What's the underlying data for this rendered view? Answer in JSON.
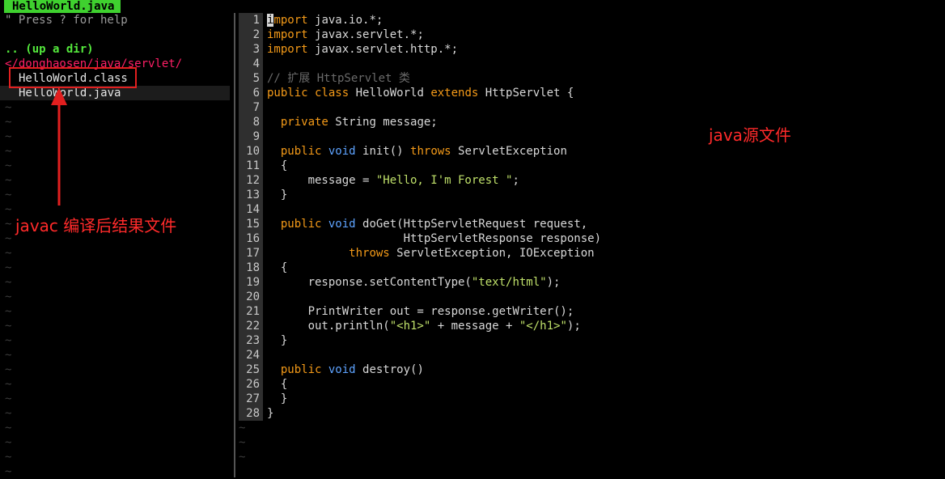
{
  "tabline": {
    "active_tab": "HelloWorld.java"
  },
  "file_tree": {
    "help_text": "\" Press ? for help",
    "up_dir": ".. (up a dir)",
    "current_dir": "</donghaosen/java/servlet/",
    "files": [
      "HelloWorld.class",
      "HelloWorld.java"
    ],
    "empty_marker": "~"
  },
  "editor": {
    "empty_marker": "~",
    "lines": [
      [
        [
          "kw",
          "import"
        ],
        [
          "n",
          " java.io.*;"
        ]
      ],
      [
        [
          "kw",
          "import"
        ],
        [
          "n",
          " javax.servlet.*;"
        ]
      ],
      [
        [
          "kw",
          "import"
        ],
        [
          "n",
          " javax.servlet.http.*;"
        ]
      ],
      [],
      [
        [
          "cm",
          "// 扩展 HttpServlet 类"
        ]
      ],
      [
        [
          "kw",
          "public class"
        ],
        [
          "n",
          " HelloWorld "
        ],
        [
          "kw",
          "extends"
        ],
        [
          "n",
          " HttpServlet {"
        ]
      ],
      [],
      [
        [
          "n",
          "  "
        ],
        [
          "kw",
          "private"
        ],
        [
          "n",
          " String message;"
        ]
      ],
      [],
      [
        [
          "n",
          "  "
        ],
        [
          "kw",
          "public"
        ],
        [
          "n",
          " "
        ],
        [
          "ty",
          "void"
        ],
        [
          "n",
          " init() "
        ],
        [
          "kw",
          "throws"
        ],
        [
          "n",
          " ServletException"
        ]
      ],
      [
        [
          "n",
          "  {"
        ]
      ],
      [
        [
          "n",
          "      message = "
        ],
        [
          "str",
          "\"Hello, I'm Forest \""
        ],
        [
          "n",
          ";"
        ]
      ],
      [
        [
          "n",
          "  }"
        ]
      ],
      [],
      [
        [
          "n",
          "  "
        ],
        [
          "kw",
          "public"
        ],
        [
          "n",
          " "
        ],
        [
          "ty",
          "void"
        ],
        [
          "n",
          " doGet(HttpServletRequest request,"
        ]
      ],
      [
        [
          "n",
          "                    HttpServletResponse response)"
        ]
      ],
      [
        [
          "n",
          "            "
        ],
        [
          "kw",
          "throws"
        ],
        [
          "n",
          " ServletException, IOException"
        ]
      ],
      [
        [
          "n",
          "  {"
        ]
      ],
      [
        [
          "n",
          "      response.setContentType("
        ],
        [
          "str",
          "\"text/html\""
        ],
        [
          "n",
          ");"
        ]
      ],
      [],
      [
        [
          "n",
          "      PrintWriter out = response.getWriter();"
        ]
      ],
      [
        [
          "n",
          "      out.println("
        ],
        [
          "str",
          "\"<h1>\""
        ],
        [
          "n",
          " + message + "
        ],
        [
          "str",
          "\"</h1>\""
        ],
        [
          "n",
          ");"
        ]
      ],
      [
        [
          "n",
          "  }"
        ]
      ],
      [],
      [
        [
          "n",
          "  "
        ],
        [
          "kw",
          "public"
        ],
        [
          "n",
          " "
        ],
        [
          "ty",
          "void"
        ],
        [
          "n",
          " destroy()"
        ]
      ],
      [
        [
          "n",
          "  {"
        ]
      ],
      [
        [
          "n",
          "  }"
        ]
      ],
      [
        [
          "n",
          "}"
        ]
      ]
    ]
  },
  "annotations": {
    "compiled_note": "javac 编译后结果文件",
    "source_note": "java源文件"
  },
  "colors": {
    "tab_bg": "#3fd12f",
    "keyword": "#f49a18",
    "type": "#5ea3ff",
    "string": "#bfe06a",
    "comment": "#6a6a6a",
    "annotation": "#ff2a2a",
    "directory": "#ff1f66",
    "up_dir": "#54e83c"
  }
}
